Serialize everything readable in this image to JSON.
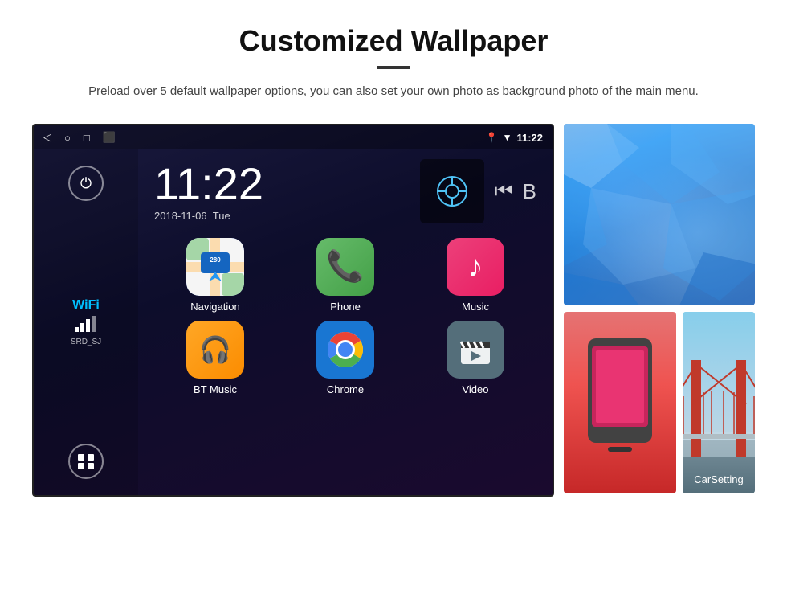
{
  "header": {
    "title": "Customized Wallpaper",
    "divider": "",
    "subtitle": "Preload over 5 default wallpaper options, you can also set your own photo as background photo of the main menu."
  },
  "statusbar": {
    "time": "11:22",
    "nav": [
      "◁",
      "○",
      "□",
      "⬛"
    ]
  },
  "clock": {
    "time": "11:22",
    "date": "2018-11-06",
    "day": "Tue"
  },
  "wifi": {
    "label": "WiFi",
    "ssid": "SRD_SJ"
  },
  "apps": [
    {
      "name": "Navigation",
      "type": "navigation",
      "symbol": "🗺"
    },
    {
      "name": "Phone",
      "type": "phone",
      "symbol": "📞"
    },
    {
      "name": "Music",
      "type": "music",
      "symbol": "♪"
    },
    {
      "name": "BT Music",
      "type": "btmusic",
      "symbol": "BT"
    },
    {
      "name": "Chrome",
      "type": "chrome",
      "symbol": "⊕"
    },
    {
      "name": "Video",
      "type": "video",
      "symbol": "▶"
    }
  ],
  "wallpapers": {
    "carsetting_label": "CarSetting"
  }
}
